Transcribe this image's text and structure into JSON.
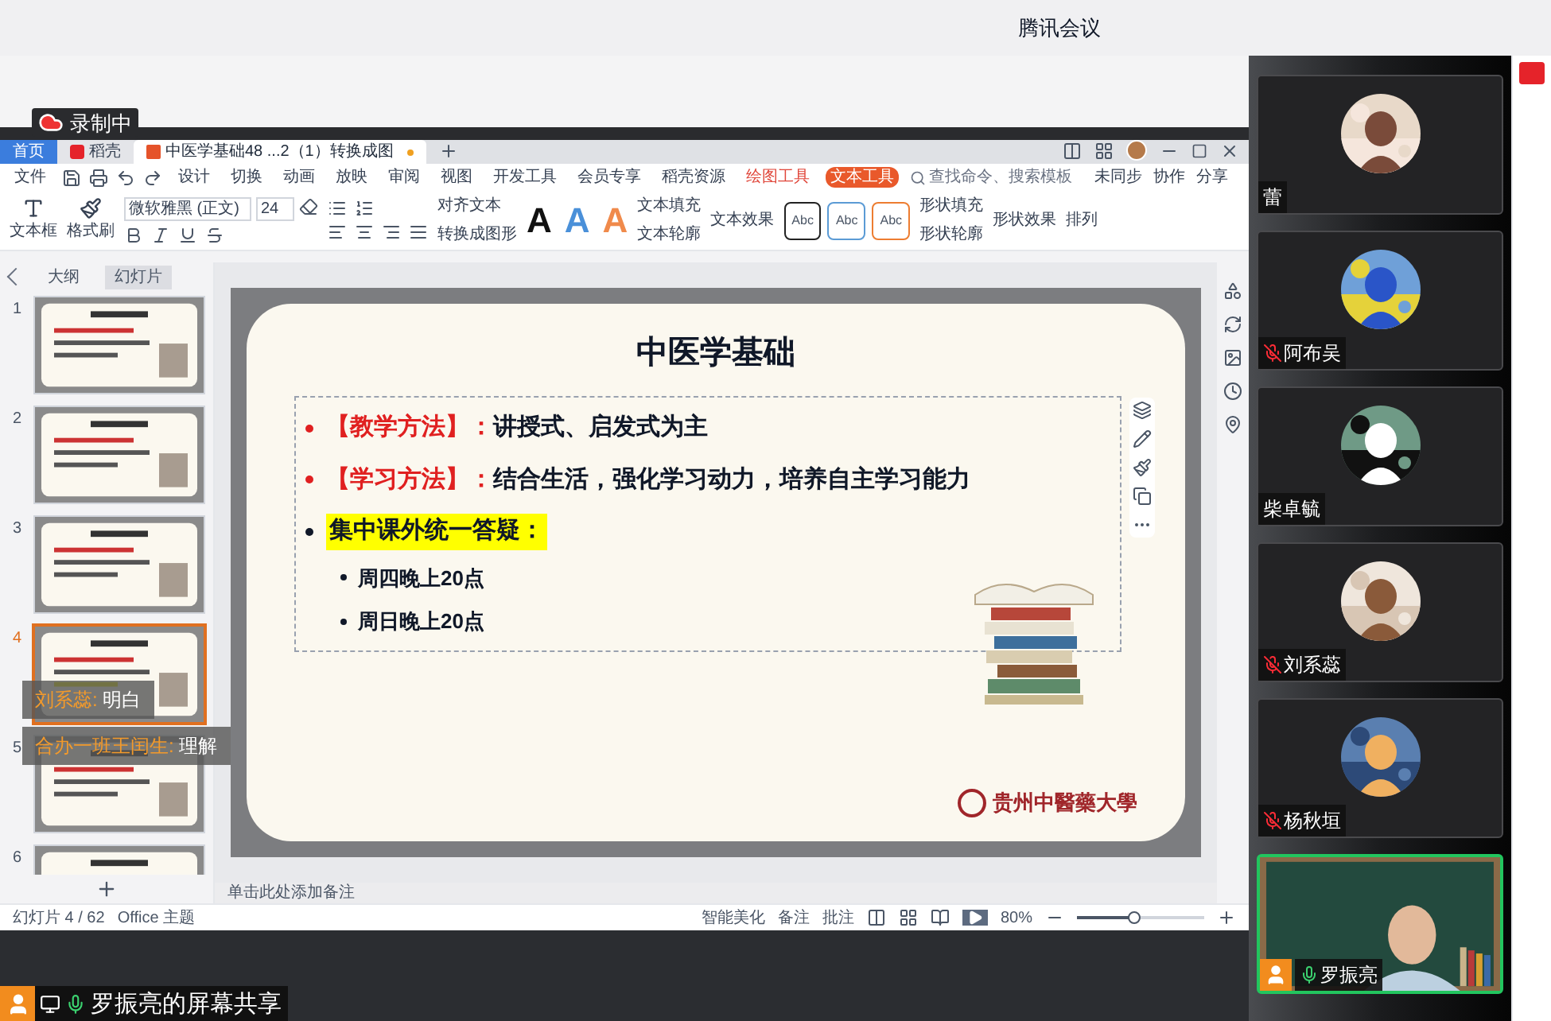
{
  "app_title": "腾讯会议",
  "recording": "录制中",
  "wps": {
    "tabs": [
      {
        "label": "首页",
        "selected": false,
        "kind": "home"
      },
      {
        "label": "稻壳",
        "selected": false,
        "kind": "docer"
      },
      {
        "label": "中医学基础48 ...2（1）转换成图",
        "selected": true,
        "kind": "doc"
      }
    ],
    "menu": [
      {
        "label": "文件",
        "selected": false,
        "kind": "file"
      },
      {
        "label": "设计",
        "selected": false,
        "kind": "plain"
      },
      {
        "label": "切换",
        "selected": false,
        "kind": "plain"
      },
      {
        "label": "动画",
        "selected": false,
        "kind": "plain"
      },
      {
        "label": "放映",
        "selected": false,
        "kind": "plain"
      },
      {
        "label": "审阅",
        "selected": false,
        "kind": "plain"
      },
      {
        "label": "视图",
        "selected": false,
        "kind": "plain"
      },
      {
        "label": "开发工具",
        "selected": false,
        "kind": "plain"
      },
      {
        "label": "会员专享",
        "selected": false,
        "kind": "plain"
      },
      {
        "label": "稻壳资源",
        "selected": false,
        "kind": "plain"
      },
      {
        "label": "绘图工具",
        "selected": false,
        "kind": "context"
      },
      {
        "label": "文本工具",
        "selected": true,
        "kind": "context"
      }
    ],
    "search": {
      "placeholder": "查找命令、搜索模板"
    },
    "actions": [
      "未同步",
      "协作",
      "分享"
    ],
    "ribbon": {
      "textbox": "文本框",
      "format_painter": "格式刷",
      "font": "微软雅黑 (正文)",
      "size": "24",
      "align_text": "对齐文本",
      "convert": "转换成图形",
      "styles": [
        {
          "label": "A",
          "color": "#111111"
        },
        {
          "label": "A",
          "color": "#4a90d9"
        },
        {
          "label": "A",
          "color": "#f08a4b"
        }
      ],
      "text_fill": "文本填充",
      "text_outline": "文本轮廓",
      "text_effect": "文本效果",
      "presets": [
        {
          "label": "Abc",
          "color": "#222222"
        },
        {
          "label": "Abc",
          "color": "#5b9bd5"
        },
        {
          "label": "Abc",
          "color": "#ed7d31"
        }
      ],
      "shape_fill": "形状填充",
      "shape_outline": "形状轮廓",
      "shape_effect": "形状效果",
      "arrange": "排列"
    },
    "panel_tabs": [
      {
        "label": "大纲",
        "selected": false
      },
      {
        "label": "幻灯片",
        "selected": true
      }
    ],
    "slides": [
      {
        "number": "1",
        "selected": false
      },
      {
        "number": "2",
        "selected": false
      },
      {
        "number": "3",
        "selected": false
      },
      {
        "number": "4",
        "selected": true
      },
      {
        "number": "5",
        "selected": false
      },
      {
        "number": "6",
        "selected": false
      }
    ],
    "chat": [
      {
        "sender": "刘系蕊:",
        "text": "明白"
      },
      {
        "sender": "合办一班王闰生:",
        "text": "理解"
      }
    ],
    "slide": {
      "title": "中医学基础",
      "bullets": [
        {
          "kind": "labeled",
          "label": "【教学方法】：",
          "text": "讲授式、启发式为主"
        },
        {
          "kind": "labeled",
          "label": "【学习方法】：",
          "text": "结合生活，强化学习动力，培养自主学习能力"
        },
        {
          "kind": "highlight",
          "text": "集中课外统一答疑：",
          "children": [
            {
              "text": "周四晚上20点"
            },
            {
              "text": "周日晚上20点"
            }
          ]
        }
      ],
      "logo_text": "贵州中醫藥大學"
    },
    "notes": {
      "placeholder": "单击此处添加备注"
    },
    "status": {
      "slide_count": "幻灯片 4 / 62",
      "theme": "Office 主题",
      "beautify": "智能美化",
      "notes": "备注",
      "comments": "批注",
      "zoom": "80%",
      "level": 0.45
    }
  },
  "participants": [
    {
      "name": "蕾",
      "muted": false,
      "active": false
    },
    {
      "name": "阿布吴",
      "muted": true,
      "active": false
    },
    {
      "name": "柴卓毓",
      "muted": false,
      "active": false
    },
    {
      "name": "刘系蕊",
      "muted": true,
      "active": false
    },
    {
      "name": "杨秋垣",
      "muted": true,
      "active": false
    },
    {
      "name": "罗振亮",
      "muted": false,
      "active": true
    }
  ],
  "share_label": "罗振亮的屏幕共享"
}
